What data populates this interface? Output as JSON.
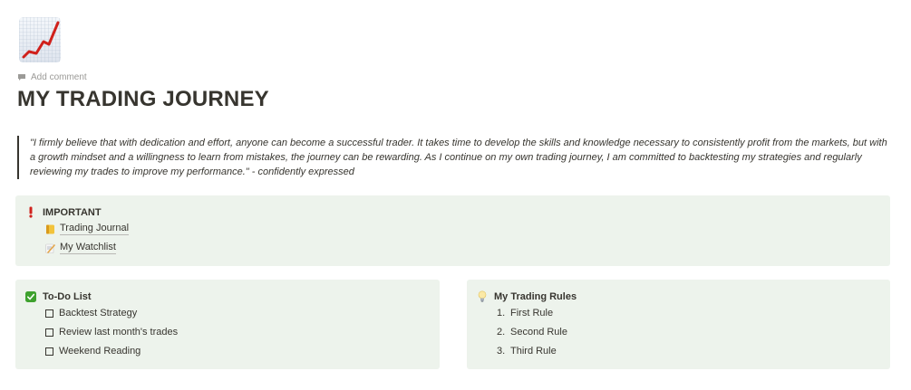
{
  "page": {
    "icon": "chart-increasing-icon",
    "add_comment_label": "Add comment",
    "title": "MY TRADING JOURNEY"
  },
  "quote": {
    "text": "\"I firmly believe that with dedication and effort, anyone can become a successful trader. It takes time to develop the skills and knowledge necessary to consistently profit from the markets, but with a growth mindset and a willingness to learn from mistakes, the journey can be rewarding. As I continue on my own trading journey, I am committed to backtesting my strategies and regularly reviewing my trades to improve my performance.\" - confidently expressed"
  },
  "important": {
    "icon": "exclamation-icon",
    "heading": "IMPORTANT",
    "links": [
      {
        "icon": "ledger-icon",
        "label": "Trading Journal"
      },
      {
        "icon": "memo-icon",
        "label": "My Watchlist"
      }
    ]
  },
  "todo": {
    "icon": "check-mark-button-icon",
    "heading": "To-Do List",
    "items": [
      {
        "label": "Backtest Strategy",
        "checked": false
      },
      {
        "label": "Review last month's trades",
        "checked": false
      },
      {
        "label": "Weekend Reading",
        "checked": false
      }
    ]
  },
  "rules": {
    "icon": "light-bulb-icon",
    "heading": "My Trading Rules",
    "items": [
      {
        "number": "1.",
        "label": "First Rule"
      },
      {
        "number": "2.",
        "label": "Second Rule"
      },
      {
        "number": "3.",
        "label": "Third Rule"
      }
    ]
  },
  "colors": {
    "callout_background": "#edf3ec",
    "text": "#37352f",
    "muted_text": "#9b9a97",
    "chart_line": "#d0211c",
    "check_green": "#3ea12e",
    "exclamation_red": "#d0211c"
  }
}
